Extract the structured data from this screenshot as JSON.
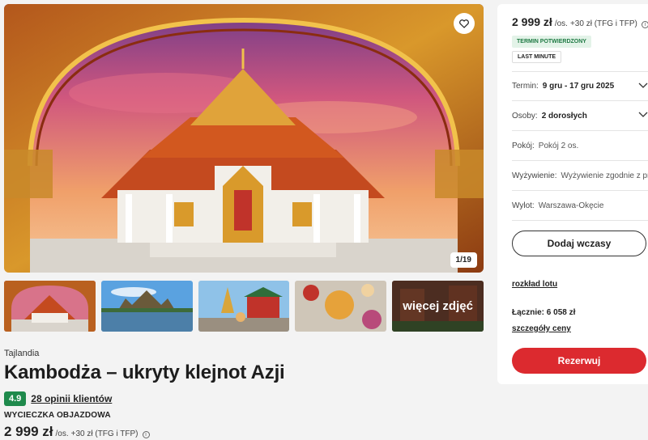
{
  "gallery": {
    "counter": "1/19",
    "more_photos_label": "więcej zdjęć"
  },
  "offer": {
    "country": "Tajlandia",
    "title": "Kambodża – ukryty klejnot Azji",
    "rating": "4.9",
    "reviews": "28 opinii klientów",
    "tour_type": "WYCIECZKA OBJAZDOWA",
    "price": "2 999 zł",
    "per_person": "/os.",
    "extra": "+30 zł (TFG i TFP)"
  },
  "panel": {
    "price": "2 999 zł",
    "per_person": "/os.",
    "extra": "+30 zł (TFG i TFP)",
    "badge_confirmed": "TERMIN POTWIERDZONY",
    "badge_last_minute": "LAST MINUTE",
    "options": [
      {
        "key": "Termin:",
        "value": "9 gru - 17 gru 2025"
      },
      {
        "key": "Osoby:",
        "value": "2 dorosłych"
      },
      {
        "key": "Pokój:",
        "value": "Pokój 2 os."
      },
      {
        "key": "Wyżywienie:",
        "value": "Wyżywienie zgodnie z programem"
      },
      {
        "key": "Wylot:",
        "value": "Warszawa-Okęcie"
      }
    ],
    "add_holiday": "Dodaj wczasy",
    "flight_schedule": "rozkład lotu",
    "total": "Łącznie: 6 058 zł",
    "price_details": "szczegóły ceny",
    "book": "Rezerwuj"
  },
  "colors": {
    "accent_red": "#dc2a2f",
    "rating_green": "#1f8a4c"
  }
}
